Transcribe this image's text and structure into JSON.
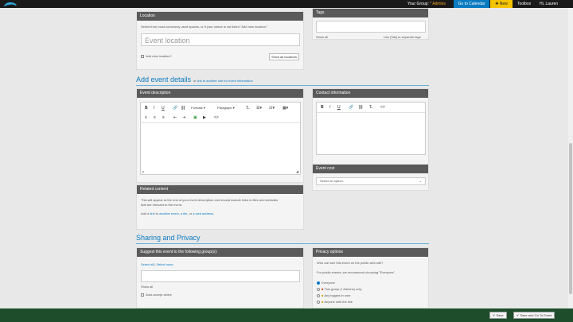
{
  "topbar": {
    "group_label": "Your Group:",
    "group_value": "* Admins",
    "go_to_calendar": "Go to Calendar",
    "new": "New",
    "toolbox": "Toolbox",
    "greeting": "Hi, Lauren"
  },
  "location": {
    "heading": "Location",
    "hint": "Select from most commonly used spaces, or if your venue is not listed \"Add new location\".",
    "placeholder": "Event location",
    "add_new": "Add new location?",
    "show_all": "Show all locations"
  },
  "tags": {
    "heading": "Tags",
    "show_all": "Show all",
    "hint": "Use [Tab] to separate tags"
  },
  "add_details": {
    "title": "Add event details",
    "sub_prefix": "or",
    "sub_link": "link to another site for event information"
  },
  "event_description": {
    "heading": "Event description",
    "formats": "Formats",
    "paragraph": "Paragraph"
  },
  "contact": {
    "heading": "Contact information"
  },
  "event_cost": {
    "heading": "Event cost",
    "select": "Select an option:"
  },
  "related": {
    "heading": "Related content",
    "desc1": "This will appear at the end of your event description and should include links to files and websites",
    "desc2": "that are relevant to the event.",
    "add_prefix": "Add a",
    "link_text": "link",
    "to": "to",
    "another_event": "another event",
    "comma": ",",
    "a_file": "a file",
    "or": ", or",
    "web_address": "a web address"
  },
  "sharing": {
    "title": "Sharing and Privacy",
    "suggest_heading": "Suggest this event to the following group(s):",
    "select_all": "Select all",
    "select_none": "Select none",
    "show_all": "Show all",
    "auto_accept": "Auto-accept active"
  },
  "privacy": {
    "heading": "Privacy options",
    "question": "Who can see this event on the public web site?",
    "recommend": "For public events, we recommend choosing \"Everyone\".",
    "options": [
      "Everyone",
      "This group (* Admins) only",
      "Any logged-in user",
      "Anyone with the link"
    ]
  },
  "footer": {
    "save": "Save",
    "save_go": "Save and Go To Event"
  }
}
